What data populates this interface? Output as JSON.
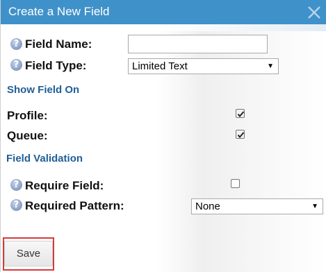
{
  "dialog": {
    "title": "Create a New Field",
    "close_icon": "close-x-icon"
  },
  "fields": {
    "field_name": {
      "label": "Field Name:",
      "value": "",
      "help_icon": "help-question-icon"
    },
    "field_type": {
      "label": "Field Type:",
      "selected": "Limited Text",
      "help_icon": "help-question-icon"
    }
  },
  "show_field_on": {
    "heading": "Show Field On",
    "profile": {
      "label": "Profile:",
      "checked": true
    },
    "queue": {
      "label": "Queue:",
      "checked": true
    }
  },
  "field_validation": {
    "heading": "Field Validation",
    "require_field": {
      "label": "Require Field:",
      "checked": false,
      "help_icon": "help-question-icon"
    },
    "required_pattern": {
      "label": "Required Pattern:",
      "selected": "None",
      "help_icon": "help-question-icon"
    }
  },
  "actions": {
    "save_label": "Save"
  },
  "colors": {
    "titlebar": "#3f91c9",
    "section_heading": "#1f5f96",
    "save_highlight": "#d63a3a"
  }
}
